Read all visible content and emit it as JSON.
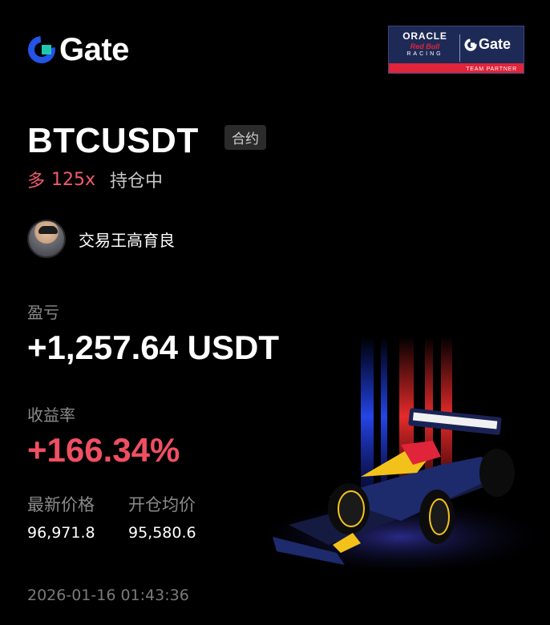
{
  "brand": {
    "name": "Gate",
    "accent": "#2354e6"
  },
  "partner_badge": {
    "oracle": "ORACLE",
    "redbull": "Red Bull",
    "racing": "RACING",
    "gate": "Gate",
    "tagline": "TEAM PARTNER"
  },
  "symbol": "BTCUSDT",
  "contract_tag": "合约",
  "position": {
    "side": "多",
    "leverage": "125x",
    "status": "持仓中"
  },
  "trader": {
    "name": "交易王高育良"
  },
  "pnl": {
    "label": "盈亏",
    "value": "+1,257.64 USDT"
  },
  "roi": {
    "label": "收益率",
    "value": "+166.34%"
  },
  "prices": {
    "last_label": "最新价格",
    "last_value": "96,971.8",
    "open_label": "开仓均价",
    "open_value": "95,580.6"
  },
  "timestamp": "2026-01-16 01:43:36",
  "colors": {
    "positive": "#ef4f63",
    "muted": "#8a8a8a",
    "background": "#000000"
  }
}
